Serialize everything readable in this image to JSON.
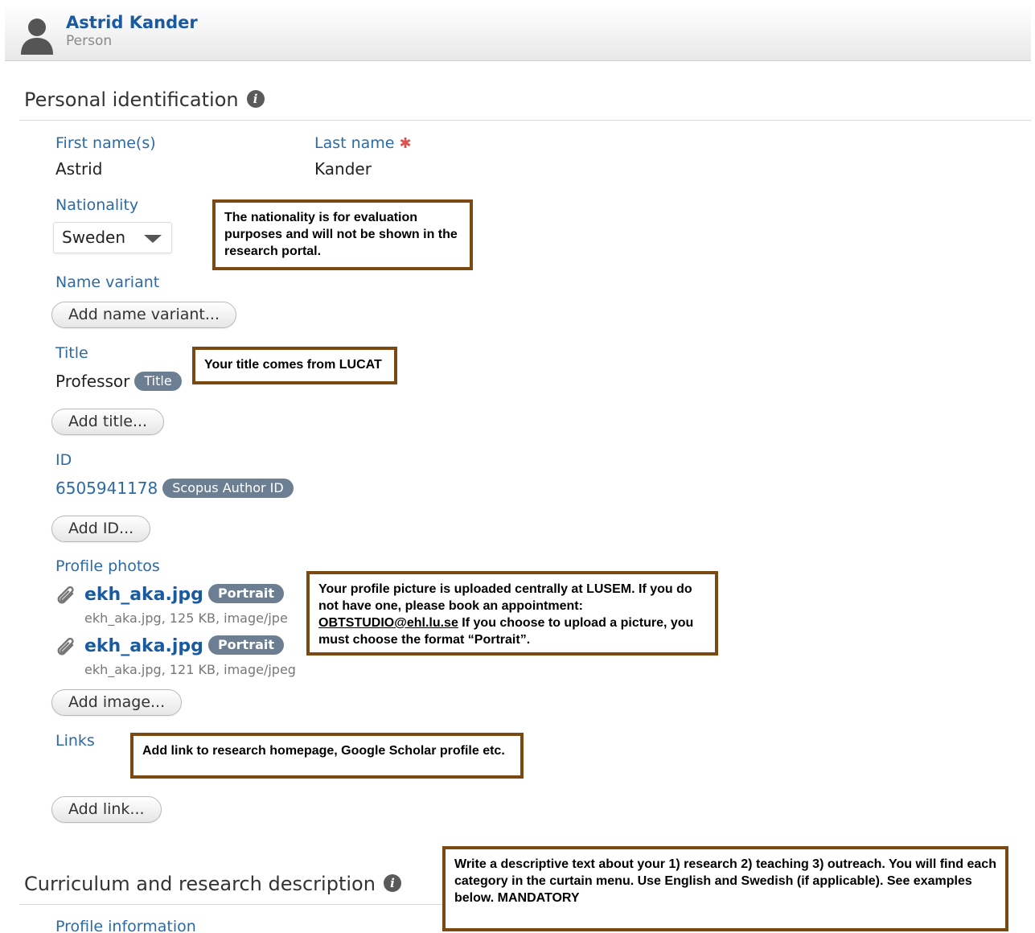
{
  "header": {
    "name": "Astrid Kander",
    "type": "Person"
  },
  "personal_identification": {
    "title": "Personal identification",
    "first_name_label": "First name(s)",
    "first_name": "Astrid",
    "last_name_label": "Last name",
    "last_name": "Kander",
    "required_marker": "✱",
    "nationality_label": "Nationality",
    "nationality": "Sweden",
    "name_variant_label": "Name variant",
    "add_name_variant": "Add name variant...",
    "title_label": "Title",
    "title_value": "Professor",
    "title_badge": "Title",
    "add_title": "Add title...",
    "id_label": "ID",
    "id_value": "6505941178",
    "id_badge": "Scopus Author ID",
    "add_id": "Add ID...",
    "photos_label": "Profile photos",
    "photos": [
      {
        "name": "ekh_aka.jpg",
        "badge": "Portrait",
        "meta": "ekh_aka.jpg, 125 KB, image/jpe"
      },
      {
        "name": "ekh_aka.jpg",
        "badge": "Portrait",
        "meta": "ekh_aka.jpg, 121 KB, image/jpeg"
      }
    ],
    "add_image": "Add image...",
    "links_label": "Links",
    "add_link": "Add link..."
  },
  "curriculum": {
    "title": "Curriculum and research description",
    "profile_information": "Profile information"
  },
  "notes": {
    "nationality": "The nationality is for evaluation purposes and will not be shown in the research portal.",
    "title": "Your title comes from LUCAT",
    "photo_part1": "Your profile picture is uploaded centrally at LUSEM. If you do not have one, please book an appointment:",
    "photo_email": "OBTSTUDIO@ehl.lu.se",
    "photo_part2": "If you choose to upload a picture, you must choose the format “Portrait”.",
    "links": "Add link to research homepage, Google Scholar profile etc.",
    "curriculum": "Write a descriptive text about your 1) research 2) teaching 3) outreach. You will find each category in the curtain menu. Use English and Swedish (if applicable). See examples below. MANDATORY"
  }
}
